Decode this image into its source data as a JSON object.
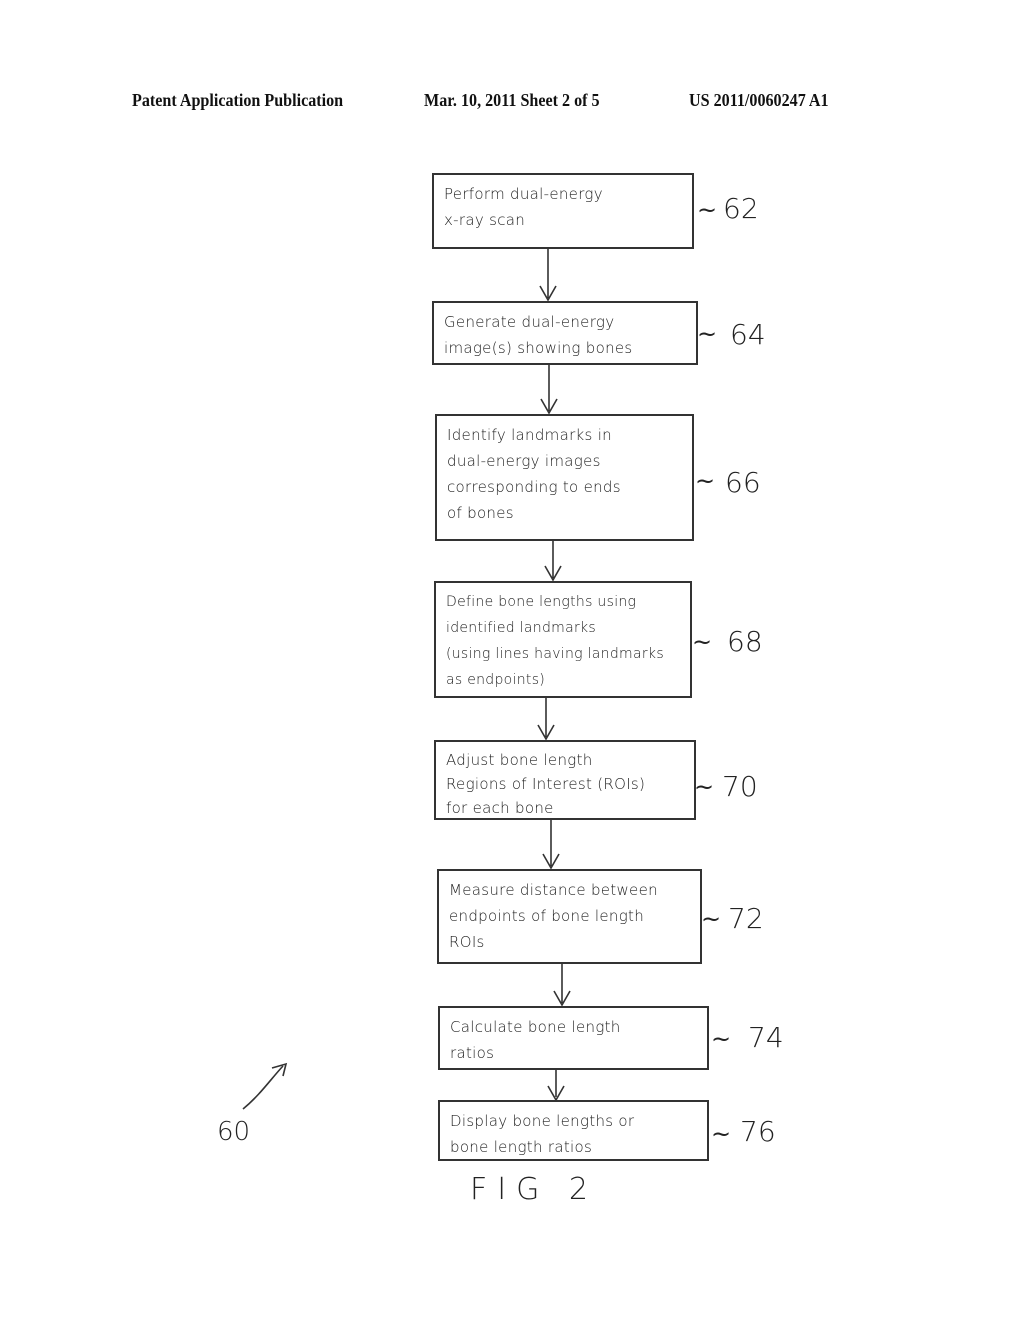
{
  "header": {
    "publication": "Patent Application Publication",
    "date_sheet": "Mar. 10, 2011  Sheet 2 of 5",
    "number": "US 2011/0060247 A1"
  },
  "figure": {
    "label": "FIG 2",
    "reference": "60",
    "steps": [
      {
        "ref": "62",
        "text": "Perform dual-energy\nx-ray scan"
      },
      {
        "ref": "64",
        "text": "Generate dual-energy\nimage(s) showing bones"
      },
      {
        "ref": "66",
        "text": "Identify landmarks in\ndual-energy images\ncorresponding to ends\nof bones"
      },
      {
        "ref": "68",
        "text": "Define bone lengths using\nidentified landmarks\n(using lines having landmarks\nas endpoints)"
      },
      {
        "ref": "70",
        "text": "Adjust bone length\nRegions of Interest (ROIs)\nfor each bone"
      },
      {
        "ref": "72",
        "text": "Measure distance between\nendpoints of bone length\nROIs"
      },
      {
        "ref": "74",
        "text": "Calculate bone length\nratios"
      },
      {
        "ref": "76",
        "text": "Display bone lengths or\nbone length ratios"
      }
    ]
  }
}
